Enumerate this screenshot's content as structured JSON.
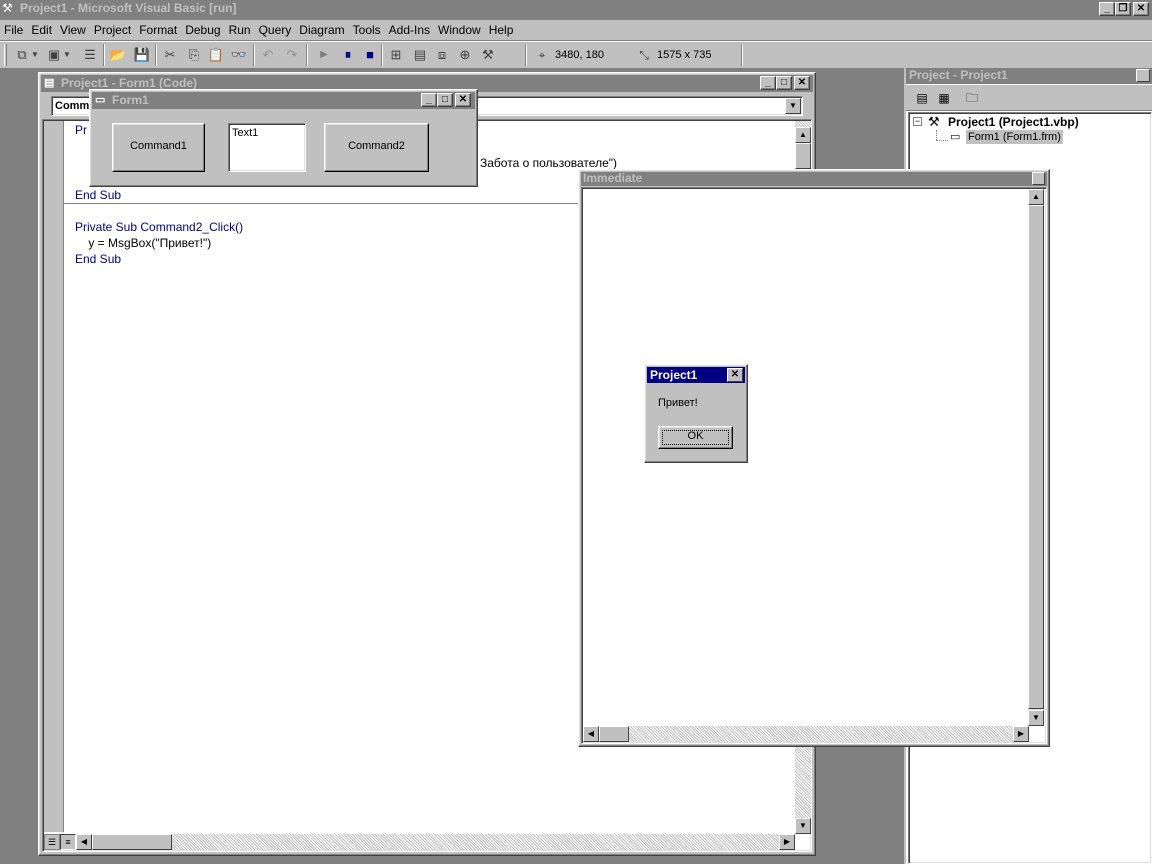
{
  "app": {
    "title": "Project1 - Microsoft Visual Basic [run]"
  },
  "menu": [
    "File",
    "Edit",
    "View",
    "Project",
    "Format",
    "Debug",
    "Run",
    "Query",
    "Diagram",
    "Tools",
    "Add-Ins",
    "Window",
    "Help"
  ],
  "toolbar": {
    "position": "3480, 180",
    "size": "1575 x 735"
  },
  "code_window": {
    "title": "Project1 - Form1 (Code)",
    "object_combo": "Comm",
    "lines": {
      "l1_prefix": "Pr",
      "l2_tail": "Забота о пользователе\")",
      "l3": "End Sub",
      "l4": "Private Sub Command2_Click()",
      "l5": "    y = MsgBox(\"Привет!\")",
      "l6": "End Sub"
    }
  },
  "form1": {
    "title": "Form1",
    "button1": "Command1",
    "textbox": "Text1",
    "button2": "Command2"
  },
  "project_explorer": {
    "title": "Project - Project1",
    "root": "Project1 (Project1.vbp)",
    "child": "Form1 (Form1.frm)"
  },
  "immediate": {
    "title": "Immediate"
  },
  "msgbox": {
    "title": "Project1",
    "message": "Привет!",
    "ok": "OK"
  },
  "colors": {
    "active_title": "#000080",
    "inactive_title": "#808080",
    "face": "#c0c0c0"
  }
}
